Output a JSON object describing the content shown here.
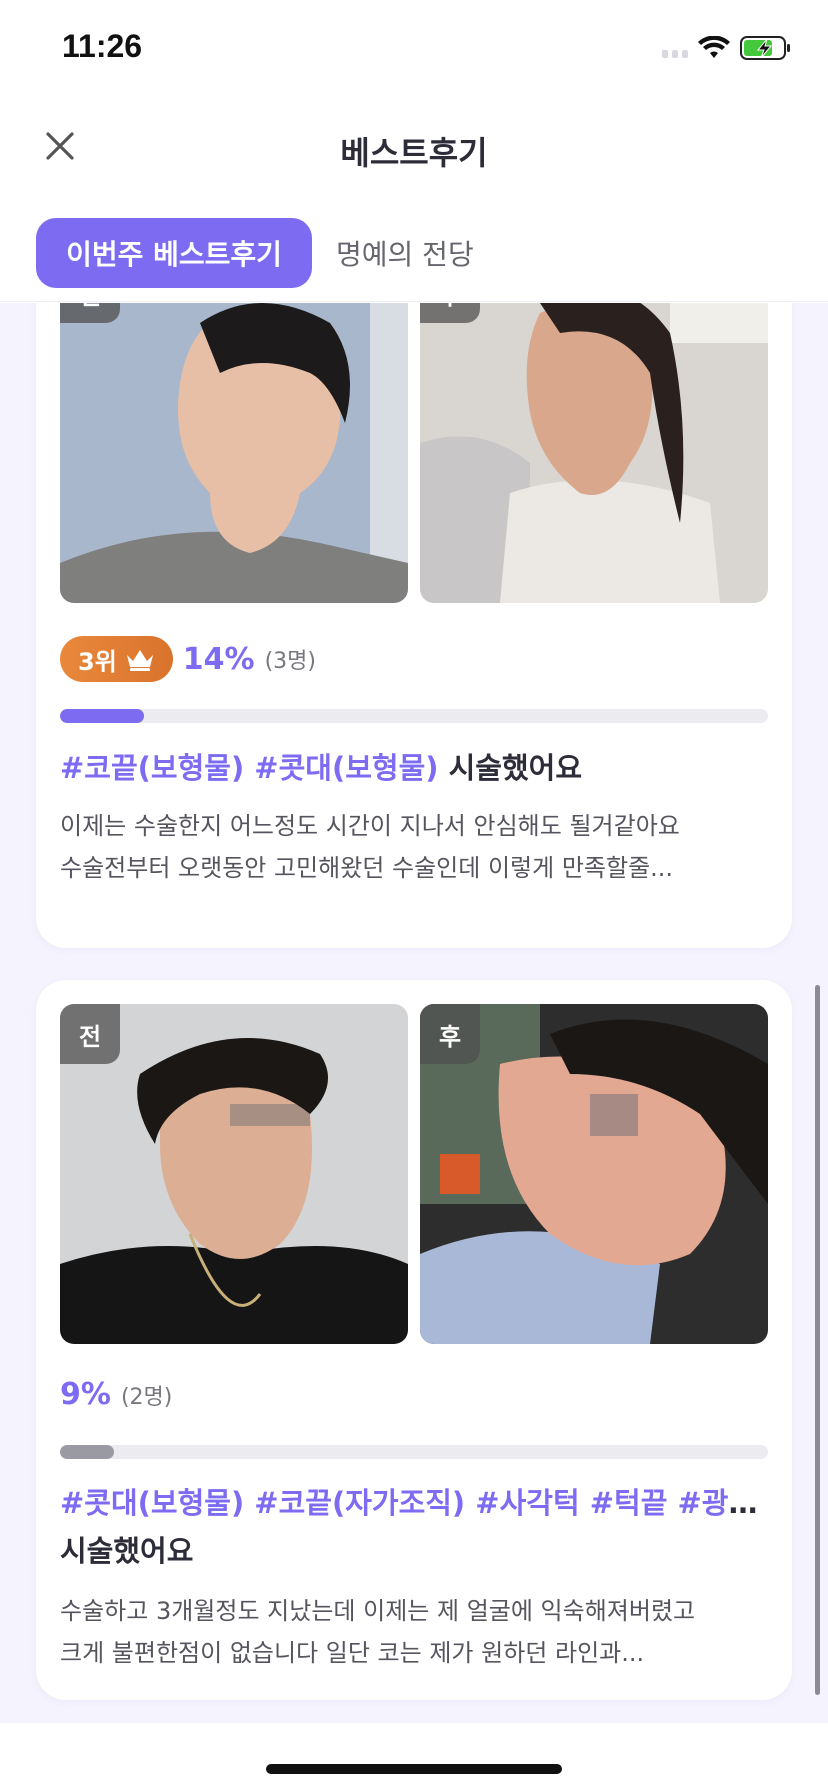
{
  "status": {
    "time": "11:26"
  },
  "nav": {
    "title": "베스트후기",
    "close_icon": "close-icon"
  },
  "tabs": {
    "active": "이번주 베스트후기",
    "other": "명예의 전당"
  },
  "colors": {
    "accent": "#7d6cf2",
    "rank_badge": "#e0802f",
    "bar_grey": "#9a9aa3"
  },
  "cards": [
    {
      "before_label": "전",
      "after_label": "후",
      "rank_label": "3위",
      "percent": "14%",
      "percent_value": 0.14,
      "count": "(3명)",
      "tags": "#코끝(보형물) #콧대(보형물)",
      "suffix": " 시술했어요",
      "desc1": "이제는 수술한지 어느정도 시간이 지나서 안심해도 될거같아요",
      "desc2": "수술전부터 오랫동안 고민해왔던 수술인데 이렇게 만족할줄..."
    },
    {
      "before_label": "전",
      "after_label": "후",
      "percent": "9%",
      "percent_value": 0.09,
      "count": "(2명)",
      "tags": "#콧대(보형물) #코끝(자가조직) #사각턱 #턱끝 #광대...",
      "suffix": "시술했어요",
      "desc1": "수술하고 3개월정도 지났는데 이제는 제 얼굴에 익숙해져버렸고",
      "desc2": "크게 불편한점이 없습니다 일단 코는 제가 원하던 라인과..."
    }
  ]
}
